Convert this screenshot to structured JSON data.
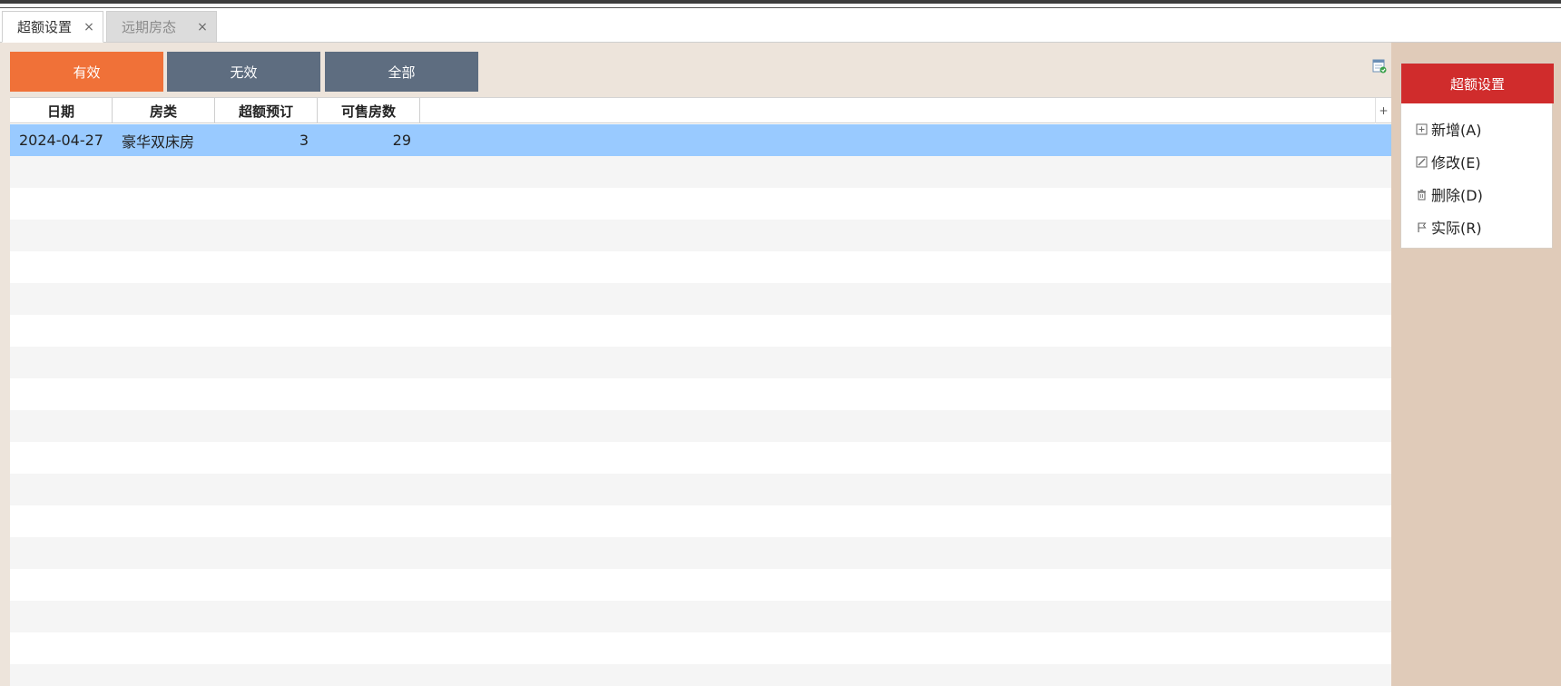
{
  "tabs": [
    {
      "label": "超额设置",
      "close": "×",
      "active": true
    },
    {
      "label": "远期房态",
      "close": "×",
      "active": false
    }
  ],
  "filters": {
    "valid_label": "有效",
    "invalid_label": "无效",
    "all_label": "全部",
    "selected": "有效"
  },
  "grid": {
    "columns": [
      "日期",
      "房类",
      "超额预订",
      "可售房数"
    ],
    "add_column_symbol": "+",
    "rows": [
      {
        "date": "2024-04-27",
        "room_type": "豪华双床房",
        "overbooking": "3",
        "available": "29"
      }
    ]
  },
  "side_panel": {
    "title": "超额设置",
    "menu": [
      {
        "label": "新增(A)",
        "icon": "plus-square-icon"
      },
      {
        "label": "修改(E)",
        "icon": "edit-icon"
      },
      {
        "label": "删除(D)",
        "icon": "trash-icon"
      },
      {
        "label": "实际(R)",
        "icon": "flag-icon"
      }
    ]
  },
  "colors": {
    "accent_orange": "#f07138",
    "button_slate": "#5e6d80",
    "panel_red": "#d02c2c",
    "selected_row": "#99caff",
    "sidebar_bg": "#e0cbb9",
    "main_bg": "#ede4db"
  }
}
